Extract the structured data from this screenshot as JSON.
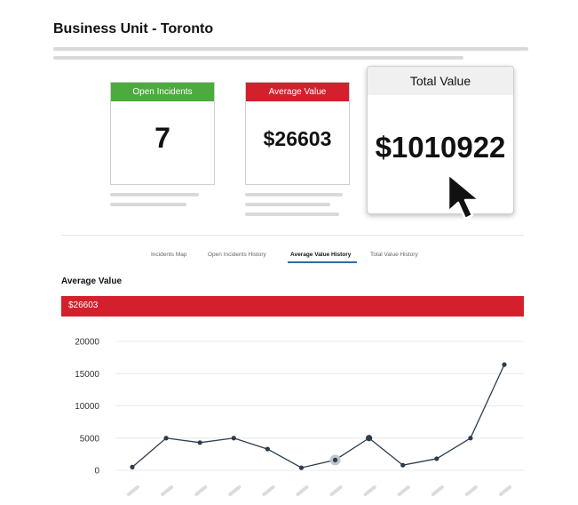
{
  "page": {
    "title": "Business Unit - Toronto"
  },
  "cards": {
    "open_incidents": {
      "label": "Open Incidents",
      "value": "7",
      "color": "#4bab3c"
    },
    "average_value": {
      "label": "Average Value",
      "value": "$26603",
      "color": "#d41f2d"
    },
    "total_value": {
      "label": "Total Value",
      "value": "$1010922"
    }
  },
  "tabs": [
    {
      "label": "Incidents Map",
      "active": false
    },
    {
      "label": "Open Incidents History",
      "active": false
    },
    {
      "label": "Average Value History",
      "active": true
    },
    {
      "label": "Total Value History",
      "active": false
    }
  ],
  "section": {
    "label": "Average Value",
    "bar_value": "$26603",
    "bar_color": "#d41f2d"
  },
  "chart_data": {
    "type": "line",
    "ylim": [
      0,
      20000
    ],
    "yticks": [
      0,
      5000,
      10000,
      15000,
      20000
    ],
    "ytick_labels": [
      "0",
      "5000",
      "10000",
      "15000",
      "20000"
    ],
    "grid": true,
    "series": [
      {
        "values": [
          500,
          5000,
          4300,
          5000,
          3300,
          400,
          1600,
          5000,
          800,
          1800,
          5000,
          16400
        ]
      }
    ],
    "highlighted_points": [
      6,
      7
    ],
    "line_color": "#2d3b4a"
  }
}
